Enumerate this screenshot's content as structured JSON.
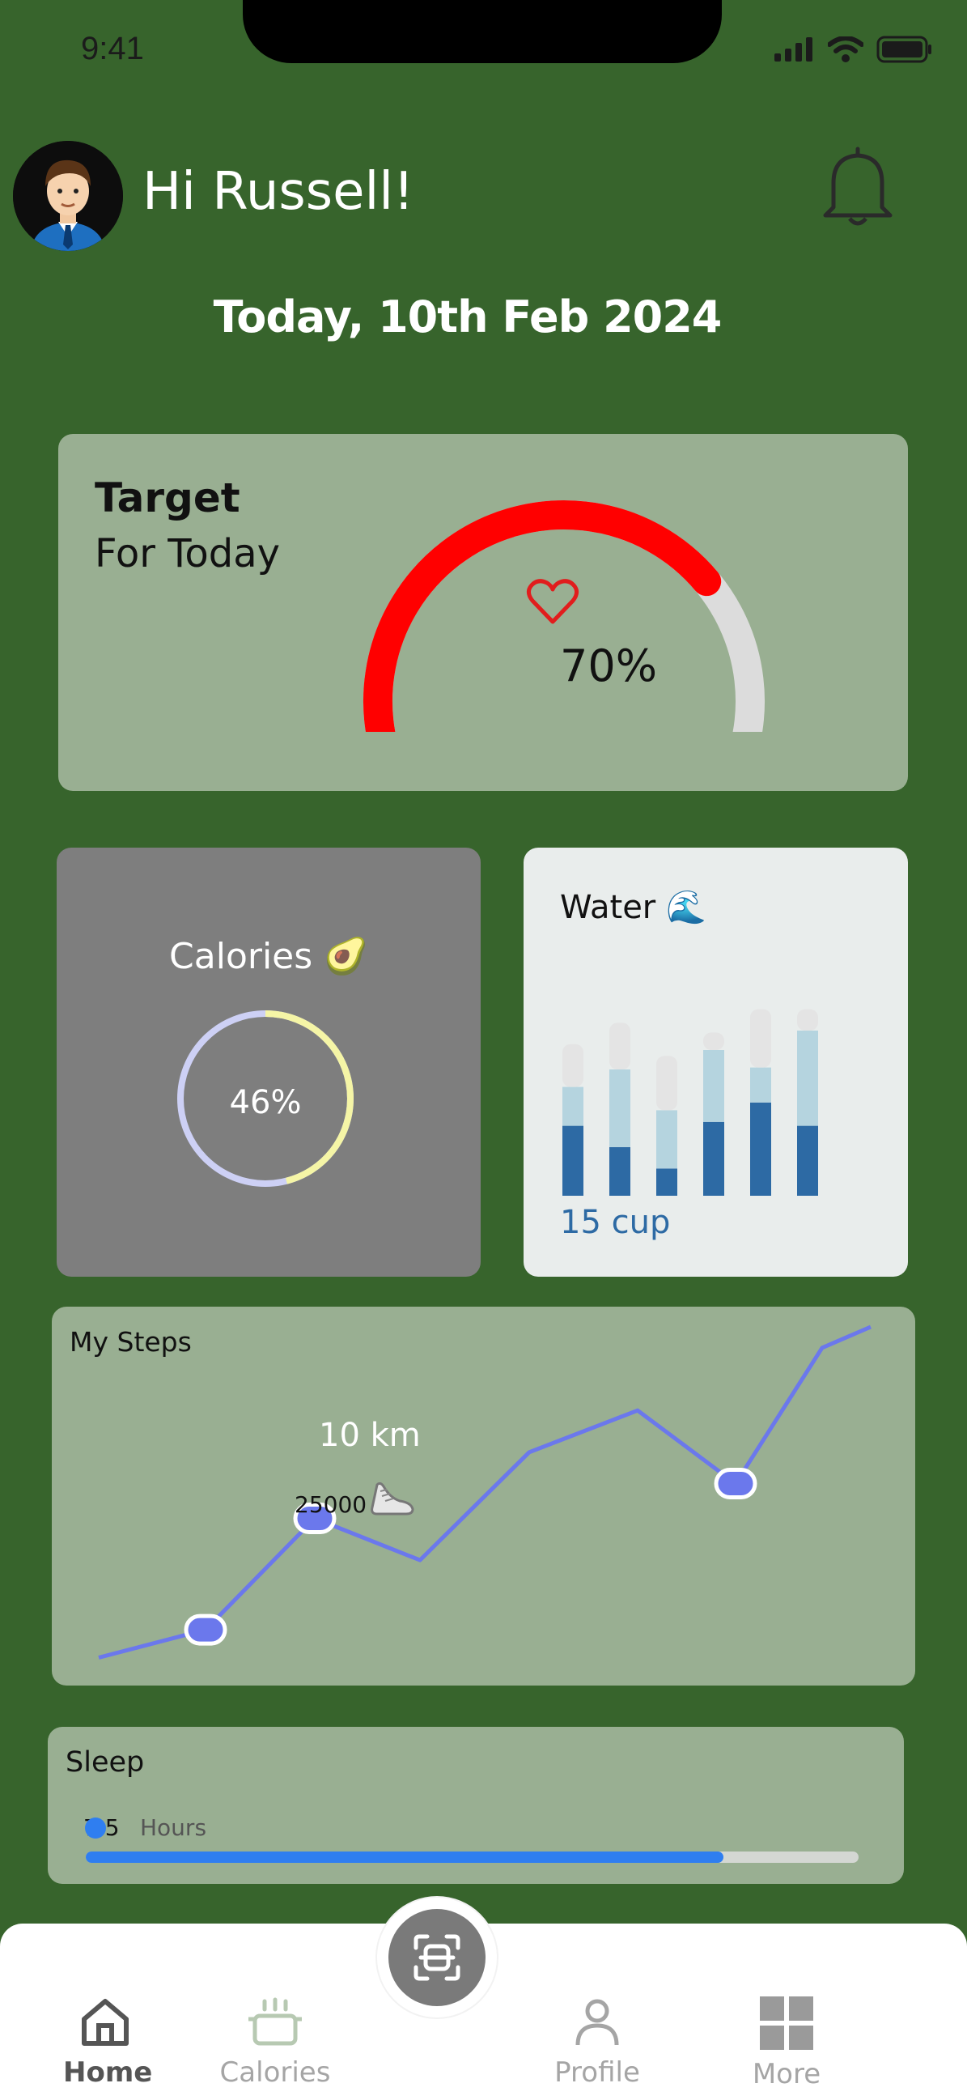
{
  "status": {
    "time": "9:41"
  },
  "header": {
    "greeting": "Hi Russell!",
    "date": "Today, 10th Feb 2024"
  },
  "target": {
    "title": "Target",
    "subtitle": "For Today",
    "value": "70%",
    "progress": 0.7,
    "color": "#ff0000"
  },
  "calories": {
    "title": "Calories 🥑",
    "value": "46%",
    "progress": 0.46,
    "colors": {
      "done": "#f5f5a6",
      "rest": "#cdd0f5"
    }
  },
  "water": {
    "title": "Water 🌊",
    "value": "15 cup",
    "chart_data": {
      "type": "bar",
      "series": [
        {
          "values": [
            0.36,
            0.25,
            0.14,
            0.38,
            0.48,
            0.36
          ]
        },
        {
          "values": [
            0.2,
            0.4,
            0.3,
            0.37,
            0.18,
            0.49
          ]
        },
        {
          "values": [
            0.22,
            0.24,
            0.28,
            0.09,
            0.3,
            0.11
          ]
        }
      ],
      "colors": [
        "#2d6aa4",
        "#b5d4df",
        "#e4e4e4"
      ]
    }
  },
  "steps": {
    "title": "My Steps",
    "distance": "10 km",
    "count": "25000",
    "chart_data": {
      "type": "line",
      "values": [
        0.05,
        0.13,
        0.45,
        0.33,
        0.64,
        0.76,
        0.55,
        0.94,
        1.0
      ],
      "highlight_indices": [
        1,
        2,
        6
      ],
      "color": "#6b78ec"
    }
  },
  "sleep": {
    "title": "Sleep",
    "value": "7.5",
    "unit": "Hours",
    "progress": 0.825
  },
  "nav": {
    "items": [
      {
        "label": "Home",
        "icon": "home-icon"
      },
      {
        "label": "Calories",
        "icon": "pot-icon"
      },
      {
        "label": "Profile",
        "icon": "profile-icon"
      },
      {
        "label": "More",
        "icon": "grid-icon"
      }
    ],
    "scan_icon": "scan-icon"
  }
}
